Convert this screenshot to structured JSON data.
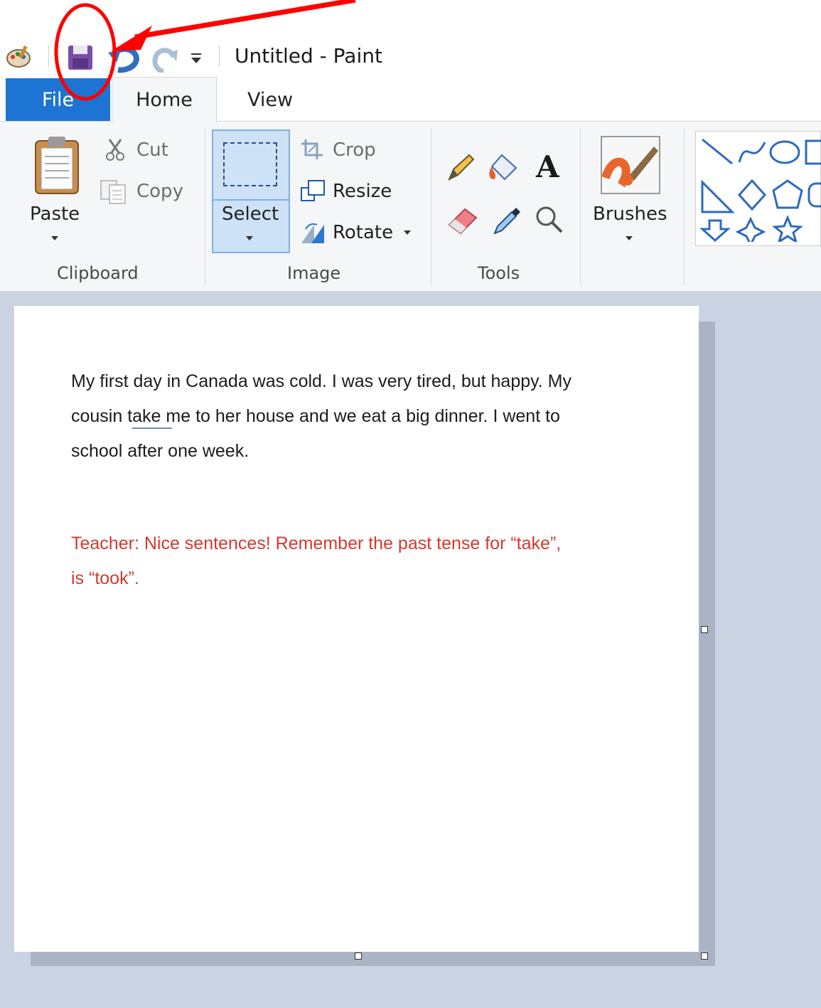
{
  "window": {
    "title": "Untitled - Paint"
  },
  "tabs": {
    "file": "File",
    "home": "Home",
    "view": "View"
  },
  "clipboard": {
    "paste": "Paste",
    "cut": "Cut",
    "copy": "Copy",
    "group_label": "Clipboard"
  },
  "image": {
    "select": "Select",
    "crop": "Crop",
    "resize": "Resize",
    "rotate": "Rotate",
    "group_label": "Image"
  },
  "tools": {
    "group_label": "Tools",
    "text_tool_glyph": "A"
  },
  "brushes": {
    "label": "Brushes"
  },
  "canvas": {
    "para1_lines": [
      "My first day in Canada was cold. I was very tired, but happy. My",
      "cousin take me to her house and we eat a big dinner. I went to",
      "school after one week."
    ],
    "para2_lines": [
      "Teacher: Nice sentences! Remember the past tense for “take”,",
      "is “took”."
    ]
  },
  "colors": {
    "file_tab": "#1d74d3",
    "annotation": "#ff0000",
    "teacher_text": "#d23a2f",
    "workspace": "#c9d3e2"
  },
  "icons": [
    "paint-app-icon",
    "save-icon",
    "undo-icon",
    "redo-icon",
    "customize-quick-access-icon",
    "paste-icon",
    "scissors-icon",
    "copy-icon",
    "select-icon",
    "crop-icon",
    "resize-icon",
    "rotate-icon",
    "pencil-icon",
    "fill-icon",
    "text-icon",
    "eraser-icon",
    "color-picker-icon",
    "magnifier-icon",
    "brushes-icon",
    "shapes-gallery"
  ]
}
